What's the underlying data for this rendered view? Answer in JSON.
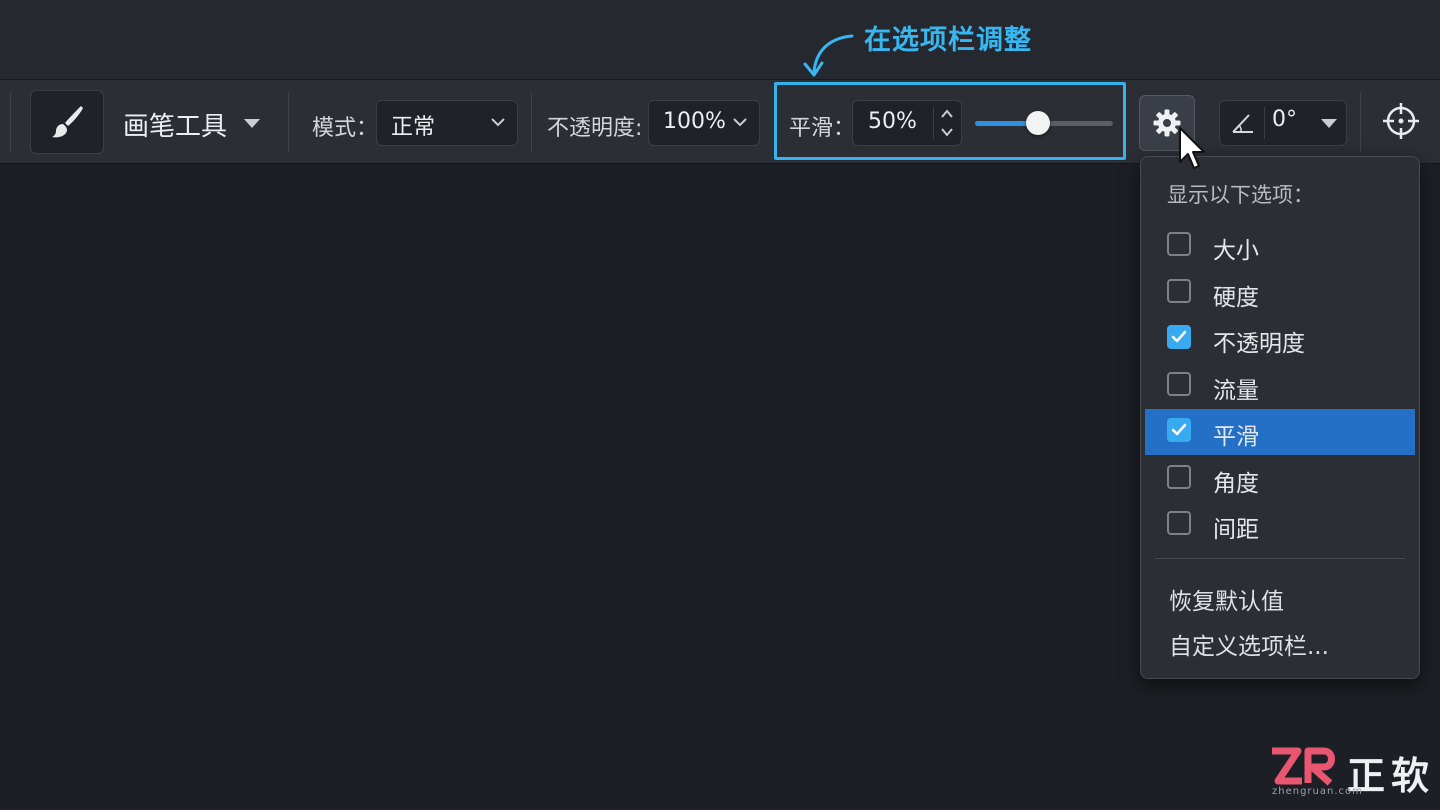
{
  "annotation": {
    "text": "在选项栏调整",
    "color": "#38b6f0"
  },
  "toolbar": {
    "tool_name": "画笔工具",
    "mode_label": "模式：",
    "mode_value": "正常",
    "opacity_label": "不透明度:",
    "opacity_value": "100%",
    "smoothing_label": "平滑：",
    "smoothing_value": "50%",
    "smoothing_slider_fraction": 0.46,
    "angle_value": "0°"
  },
  "dropdown": {
    "header": "显示以下选项：",
    "items": [
      {
        "label": "大小",
        "checked": false,
        "selected": false
      },
      {
        "label": "硬度",
        "checked": false,
        "selected": false
      },
      {
        "label": "不透明度",
        "checked": true,
        "selected": false
      },
      {
        "label": "流量",
        "checked": false,
        "selected": false
      },
      {
        "label": "平滑",
        "checked": true,
        "selected": true
      },
      {
        "label": "角度",
        "checked": false,
        "selected": false
      },
      {
        "label": "间距",
        "checked": false,
        "selected": false
      }
    ],
    "actions": [
      "恢复默认值",
      "自定义选项栏..."
    ]
  },
  "watermark": {
    "logo": "ZR",
    "text": "正软",
    "sub": "zhengruan.com"
  },
  "colors": {
    "accent": "#34b3ee",
    "selection": "#2470c6",
    "background": "#1c1f25",
    "toolbar": "#2b2e35"
  }
}
